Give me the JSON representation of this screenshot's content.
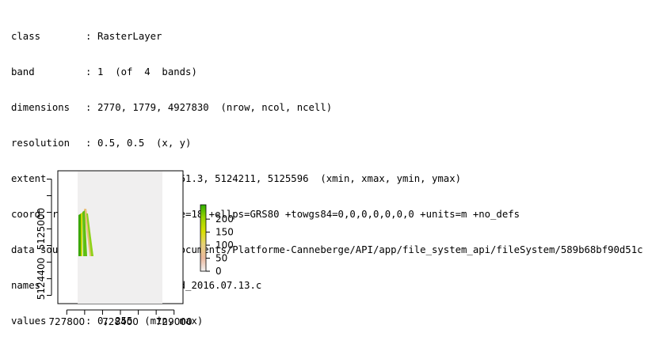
{
  "console": {
    "rows": [
      {
        "key": "class",
        "sep": ":",
        "value": "RasterLayer"
      },
      {
        "key": "band",
        "sep": ":",
        "value": "1  (of  4  bands)"
      },
      {
        "key": "dimensions",
        "sep": ":",
        "value": "2770, 1779, 4927830  (nrow, ncol, ncell)"
      },
      {
        "key": "resolution",
        "sep": ":",
        "value": "0.5, 0.5  (x, y)"
      },
      {
        "key": "extent",
        "sep": ":",
        "value": "727971.8, 728861.3, 5124211, 5125596  (xmin, xmax, ymin, ymax)"
      },
      {
        "key": "coord. ref.",
        "sep": ":",
        "value": "+proj=utm +zone=18 +ellps=GRS80 +towgs84=0,0,0,0,0,0,0 +units=m +no_defs"
      },
      {
        "key": "data source",
        "sep": ":",
        "value": "/home/bhacaz/Documents/Platforme-Canneberge/API/app/file_system_api/fileSystem/589b68bf90d51c"
      },
      {
        "key": "names",
        "sep": ":",
        "value": "Nappe_Blandford_2016.07.13.c"
      },
      {
        "key": "values",
        "sep": ":",
        "value": "0, 255  (min, max)"
      }
    ]
  },
  "chart_data": {
    "type": "heatmap",
    "x_ticks": [
      "727800",
      "728400",
      "729000"
    ],
    "y_ticks": [
      "5124400",
      "5125000"
    ],
    "xlim": [
      727700,
      729100
    ],
    "ylim": [
      5124100,
      5125700
    ],
    "raster_extent": {
      "xmin": 727971.8,
      "xmax": 728861.3,
      "ymin": 5124211,
      "ymax": 5125596
    },
    "legend_ticks": [
      "0",
      "50",
      "100",
      "150",
      "200"
    ],
    "legend_range": [
      0,
      255
    ],
    "legend_colors": [
      "#f2f2f2",
      "#ebb89c",
      "#e6d27a",
      "#d8e000",
      "#9cd400",
      "#2fb000"
    ],
    "grid": false,
    "legend_placement": "right"
  }
}
